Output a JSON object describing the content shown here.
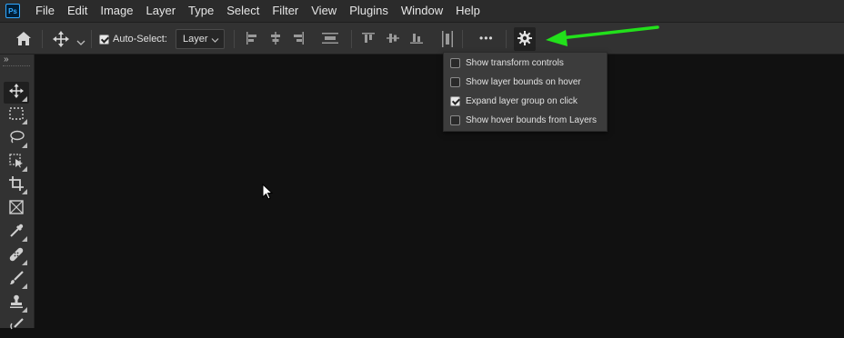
{
  "app": {
    "logo_text": "Ps"
  },
  "menu": [
    "File",
    "Edit",
    "Image",
    "Layer",
    "Type",
    "Select",
    "Filter",
    "View",
    "Plugins",
    "Window",
    "Help"
  ],
  "options_bar": {
    "auto_select_label": "Auto-Select:",
    "auto_select_checked": true,
    "layer_select_value": "Layer",
    "more_label": "•••"
  },
  "popup": {
    "items": [
      {
        "label": "Show transform controls",
        "checked": false
      },
      {
        "label": "Show layer bounds on hover",
        "checked": false
      },
      {
        "label": "Expand layer group on click",
        "checked": true
      },
      {
        "label": "Show hover bounds from Layers",
        "checked": false
      }
    ]
  },
  "annotation": {
    "arrow_color": "#22e01b"
  },
  "toolbar": {
    "collapse_label": "»",
    "tools": [
      "move-tool",
      "marquee-tool",
      "lasso-tool",
      "object-selection-tool",
      "crop-tool",
      "frame-tool",
      "eyedropper-tool",
      "healing-brush-tool",
      "brush-tool",
      "clone-stamp-tool",
      "history-brush-tool"
    ]
  },
  "colors": {
    "canvas": "#111111",
    "panel": "#323232",
    "menubar": "#2b2b2b"
  }
}
